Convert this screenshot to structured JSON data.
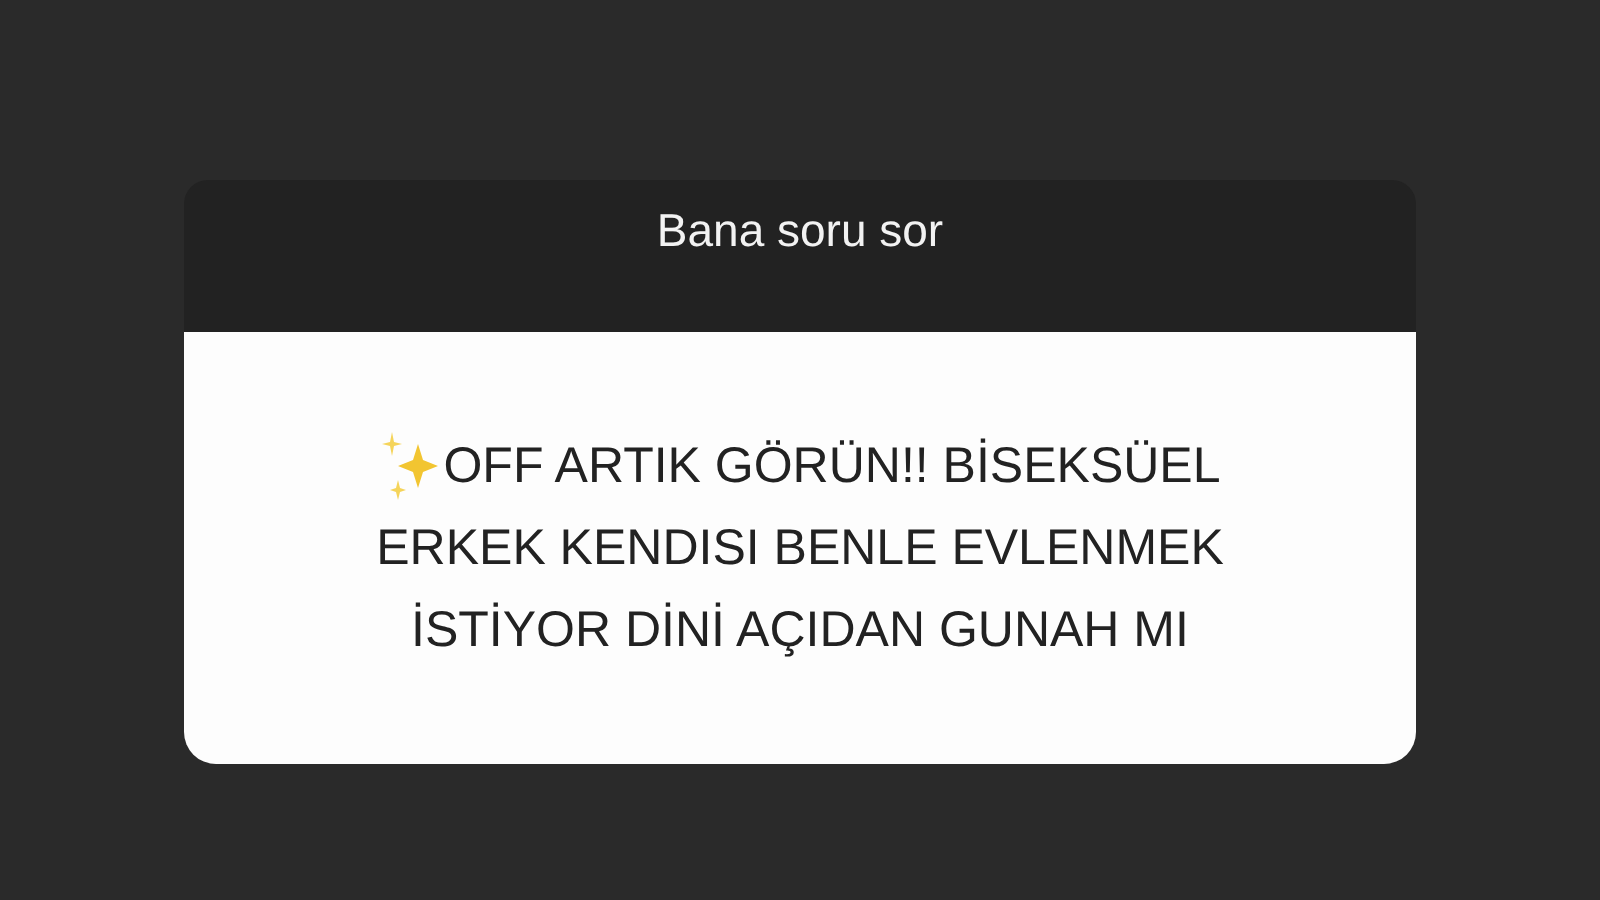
{
  "sticker": {
    "title": "Bana soru sor",
    "question_lines": [
      "OFF ARTIK GÖRÜN!! BİSEKSÜEL",
      "ERKEK KENDISI BENLE EVLENMEK",
      "İSTİYOR DİNİ AÇIDAN GUNAH MI"
    ]
  }
}
